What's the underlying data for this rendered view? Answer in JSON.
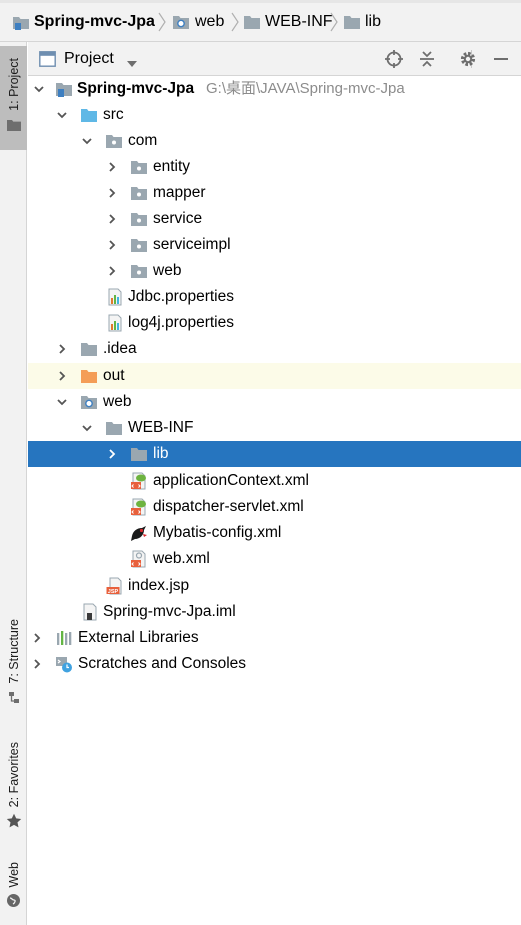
{
  "breadcrumb": {
    "items": [
      {
        "label": "Spring-mvc-Jpa",
        "icon": "project-folder-icon"
      },
      {
        "label": "web",
        "icon": "web-folder-icon"
      },
      {
        "label": "WEB-INF",
        "icon": "folder-icon"
      },
      {
        "label": "lib",
        "icon": "folder-icon"
      }
    ]
  },
  "tool_stripe": {
    "project_tab": "1: Project",
    "structure_tab": "7: Structure",
    "favorites_tab": "2: Favorites",
    "web_tab": "Web"
  },
  "panel": {
    "title": "Project",
    "view_mode": "Project"
  },
  "tree": {
    "root": {
      "label": "Spring-mvc-Jpa",
      "path": "G:\\桌面\\JAVA\\Spring-mvc-Jpa"
    },
    "src": "src",
    "com": "com",
    "entity": "entity",
    "mapper": "mapper",
    "service": "service",
    "serviceimpl": "serviceimpl",
    "web_pkg": "web",
    "jdbc_props": "Jdbc.properties",
    "log4j_props": "log4j.properties",
    "idea": ".idea",
    "out": "out",
    "web_dir": "web",
    "webinf": "WEB-INF",
    "lib": "lib",
    "app_context": "applicationContext.xml",
    "dispatcher": "dispatcher-servlet.xml",
    "mybatis": "Mybatis-config.xml",
    "web_xml": "web.xml",
    "index_jsp": "index.jsp",
    "iml": "Spring-mvc-Jpa.iml",
    "external_libraries": "External Libraries",
    "scratches": "Scratches and Consoles"
  },
  "colors": {
    "selection": "#2675bf",
    "out_highlight": "#fcfbe8",
    "folder_gray": "#9aa7b0",
    "source_folder": "#5fb8e6",
    "excluded_folder": "#f49d57"
  }
}
